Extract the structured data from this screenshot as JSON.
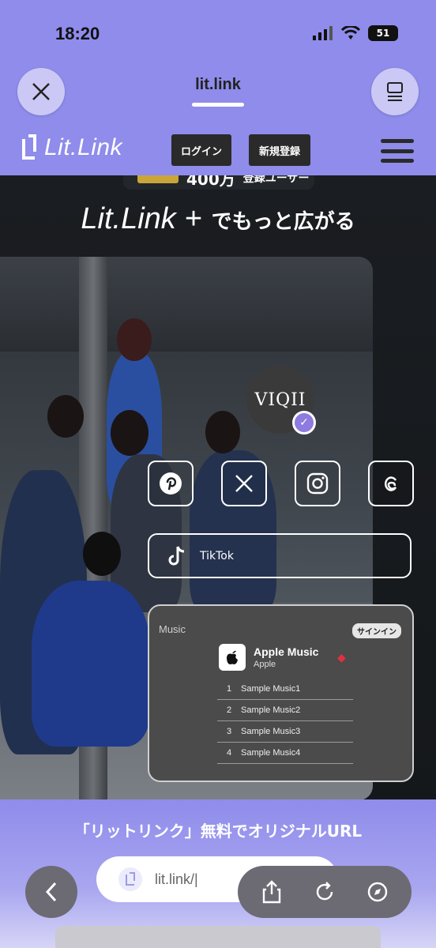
{
  "status_bar": {
    "time": "18:20",
    "battery": "51"
  },
  "browser": {
    "site_title": "lit.link"
  },
  "header": {
    "logo_text": "Lit.Link",
    "login_label": "ログイン",
    "signup_label": "新規登録"
  },
  "hero": {
    "ranking_number": "400万",
    "ranking_text": "登録ユーザー",
    "title_logo": "Lit.Link +",
    "title_sub": "でもっと広がる"
  },
  "profile": {
    "avatar_text": "VIQII",
    "socials": [
      "pinterest-icon",
      "x-icon",
      "instagram-icon",
      "threads-icon"
    ],
    "tiktok_label": "TikTok"
  },
  "music_card": {
    "brand": " Music",
    "signin_label": "サインイン",
    "title": "Apple Music",
    "artist": "Apple",
    "tracks": [
      {
        "num": "1",
        "name": "Sample Music1"
      },
      {
        "num": "2",
        "name": "Sample Music2"
      },
      {
        "num": "3",
        "name": "Sample Music3"
      },
      {
        "num": "4",
        "name": "Sample Music4"
      }
    ]
  },
  "promo": {
    "text": "「リットリンク」無料でオリジナルURL",
    "url_text": "lit.link/|"
  },
  "colors": {
    "brand_purple": "#8f8ceb",
    "dark_bg": "#1a1d21",
    "verified": "#8f7ae0"
  }
}
